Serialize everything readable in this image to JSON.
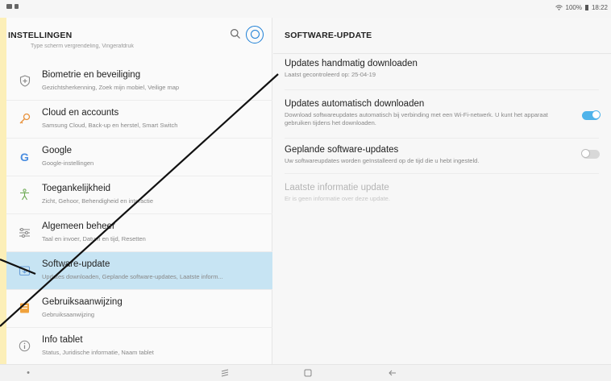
{
  "statusbar": {
    "left_icons": [
      "image-icon",
      "sd-card-icon"
    ],
    "right_text": "100%",
    "time": "18:22"
  },
  "left": {
    "title": "INSTELLINGEN",
    "cut_row": "Type scherm vergrendeling, Vingerafdruk",
    "items": [
      {
        "label": "Biometrie en beveiliging",
        "sub": "Gezichtsherkenning, Zoek mijn mobiel, Veilige map",
        "icon": "shield-icon"
      },
      {
        "label": "Cloud en accounts",
        "sub": "Samsung Cloud, Back-up en herstel, Smart Switch",
        "icon": "key-icon"
      },
      {
        "label": "Google",
        "sub": "Google-instellingen",
        "icon": "google-icon"
      },
      {
        "label": "Toegankelijkheid",
        "sub": "Zicht, Gehoor, Behendigheid en interactie",
        "icon": "accessibility-icon"
      },
      {
        "label": "Algemeen beheer",
        "sub": "Taal en invoer, Datum en tijd, Resetten",
        "icon": "sliders-icon"
      },
      {
        "label": "Software-update",
        "sub": "Updates downloaden, Geplande software-updates, Laatste inform...",
        "icon": "update-icon"
      },
      {
        "label": "Gebruiksaanwijzing",
        "sub": "Gebruiksaanwijzing",
        "icon": "manual-icon"
      },
      {
        "label": "Info tablet",
        "sub": "Status, Juridische informatie, Naam tablet",
        "icon": "info-icon"
      }
    ]
  },
  "right": {
    "title": "SOFTWARE-UPDATE",
    "settings": [
      {
        "title": "Updates handmatig downloaden",
        "sub": "Laatst gecontroleerd op: 25-04-19"
      },
      {
        "title": "Updates automatisch downloaden",
        "sub": "Download softwareupdates automatisch bij verbinding met een Wi-Fi-netwerk. U kunt het apparaat gebruiken tijdens het downloaden.",
        "toggle": "on"
      },
      {
        "title": "Geplande software-updates",
        "sub": "Uw softwareupdates worden geïnstalleerd op de tijd die u hebt ingesteld.",
        "toggle": "off"
      },
      {
        "title": "Laatste informatie update",
        "sub": "Er is geen informatie over deze update."
      }
    ]
  },
  "navbar": {
    "buttons": [
      "dot-icon",
      "recents-icon",
      "home-icon",
      "back-icon"
    ]
  },
  "colors": {
    "accent": "#1d7fd6",
    "selected_bg": "#c7e4f3",
    "toggle_on": "#4fb3ea",
    "highlight_strip": "#fcefb8"
  }
}
